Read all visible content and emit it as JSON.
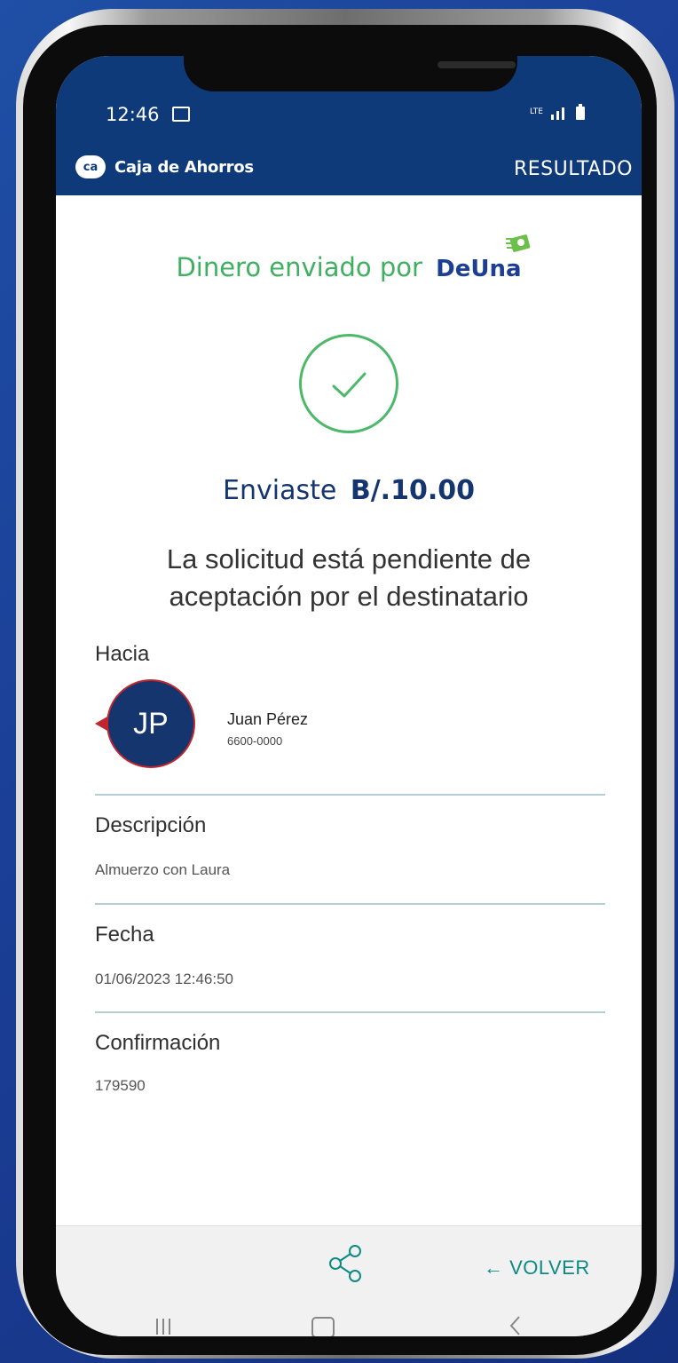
{
  "status_bar": {
    "time": "12:46",
    "network": "LTE"
  },
  "app_bar": {
    "logo_mark": "ca",
    "brand": "Caja de Ahorros",
    "screen_title": "RESULTADO"
  },
  "result": {
    "headline": "Dinero enviado por",
    "service_brand": "DeUna",
    "amount_prefix": "Enviaste",
    "amount": "B/.10.00",
    "message": "La solicitud está pendiente de aceptación por el destinatario"
  },
  "details": {
    "to_label": "Hacia",
    "recipient": {
      "initials": "JP",
      "name": "Juan Pérez",
      "phone": "6600-0000"
    },
    "description_label": "Descripción",
    "description": "Almuerzo con Laura",
    "date_label": "Fecha",
    "date": "01/06/2023 12:46:50",
    "confirmation_label": "Confirmación",
    "confirmation": "179590"
  },
  "actions": {
    "share_icon": "share-icon",
    "back_label": "← VOLVER"
  },
  "colors": {
    "primary": "#0e3a7a",
    "success": "#3fb061",
    "accent": "#0c8a83",
    "avatar_border": "#c0272d"
  }
}
